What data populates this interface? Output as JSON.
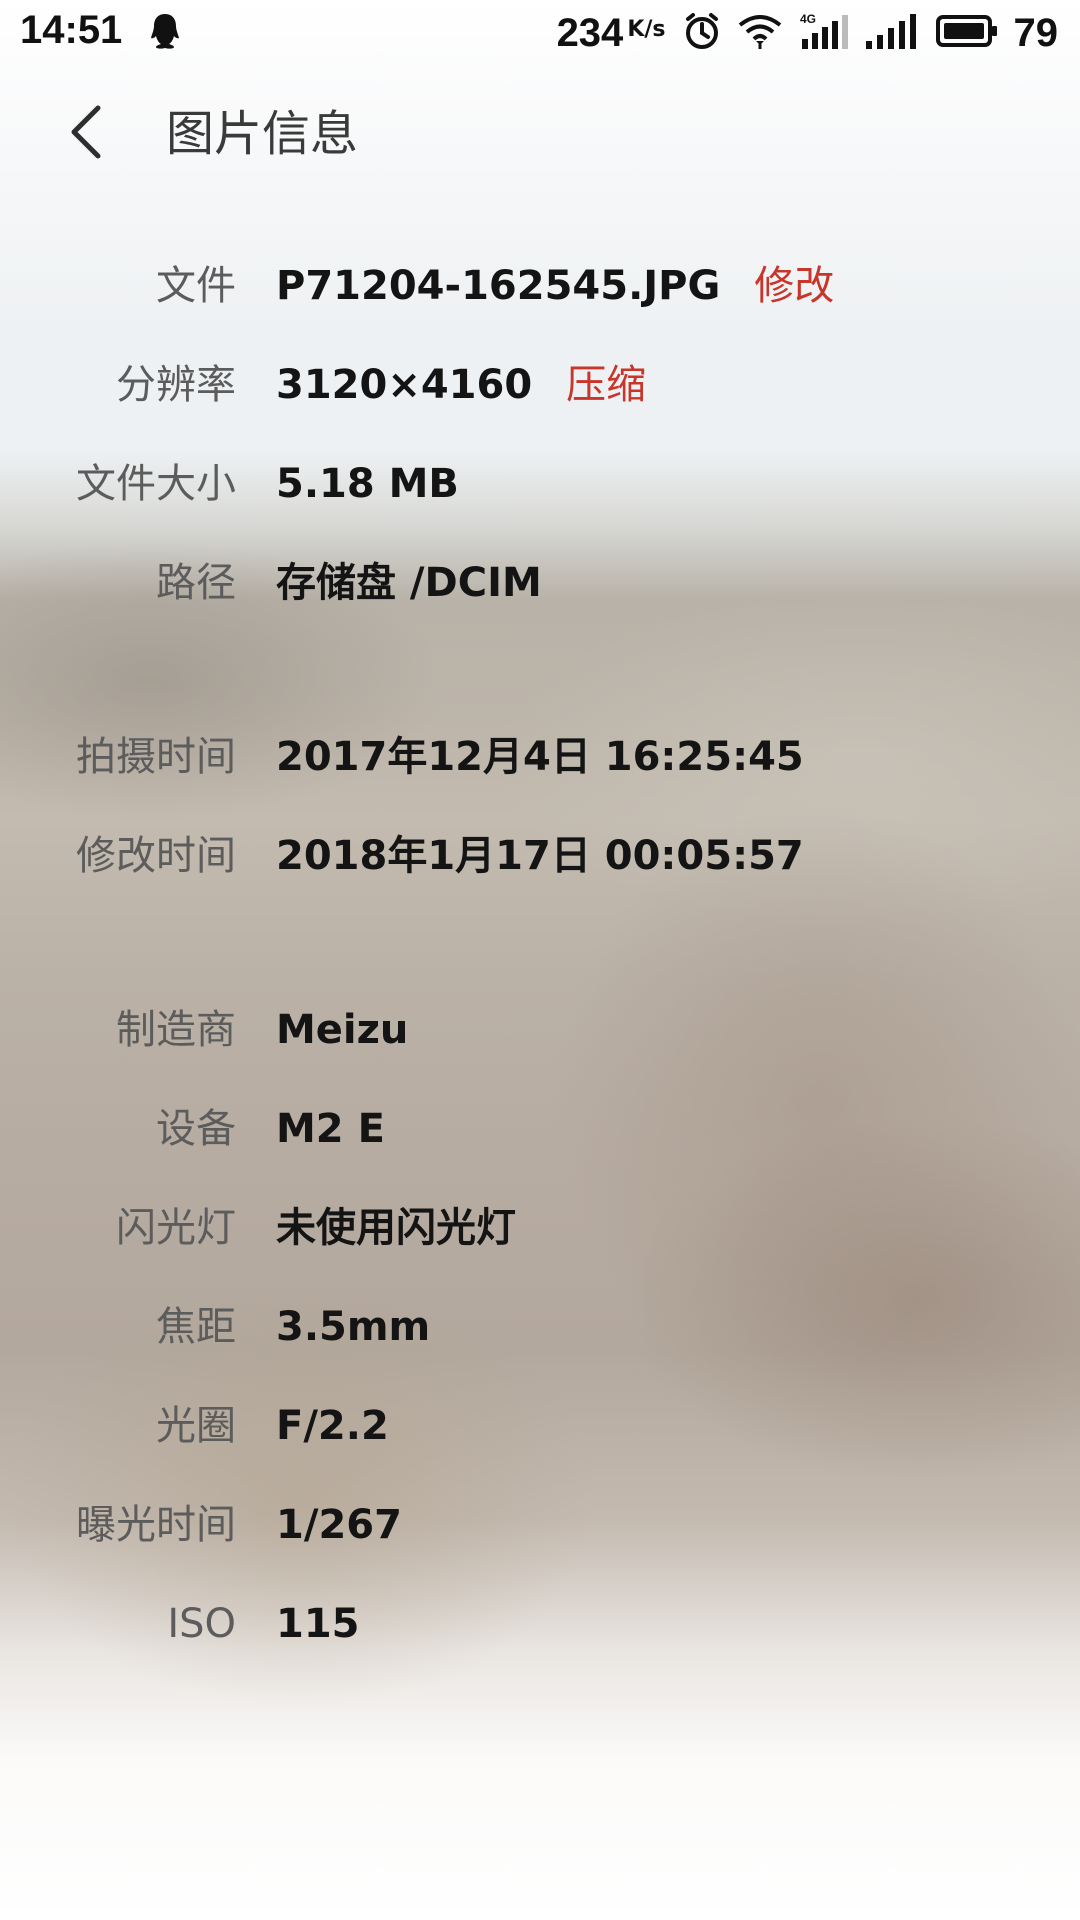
{
  "status_bar": {
    "time": "14:51",
    "net_speed": "234",
    "net_speed_unit": "K/s",
    "battery_percent": "79",
    "icons": [
      "qq-notification-icon",
      "alarm-icon",
      "wifi-icon",
      "4g-signal-icon",
      "signal-icon",
      "battery-icon"
    ]
  },
  "header": {
    "back_icon": "chevron-left-icon",
    "title": "图片信息"
  },
  "info": {
    "file": {
      "label": "文件",
      "value": "P71204-162545.JPG",
      "action": "修改"
    },
    "resolution": {
      "label": "分辨率",
      "value": "3120×4160",
      "action": "压缩"
    },
    "size": {
      "label": "文件大小",
      "value": "5.18 MB"
    },
    "path": {
      "label": "路径",
      "value": "存储盘 /DCIM"
    },
    "shot_time": {
      "label": "拍摄时间",
      "value": "2017年12月4日 16:25:45"
    },
    "modified_time": {
      "label": "修改时间",
      "value": "2018年1月17日 00:05:57"
    },
    "maker": {
      "label": "制造商",
      "value": "Meizu"
    },
    "device": {
      "label": "设备",
      "value": "M2 E"
    },
    "flash": {
      "label": "闪光灯",
      "value": "未使用闪光灯"
    },
    "focal_length": {
      "label": "焦距",
      "value": "3.5mm"
    },
    "aperture": {
      "label": "光圈",
      "value": "F/2.2"
    },
    "exposure": {
      "label": "曝光时间",
      "value": "1/267"
    },
    "iso": {
      "label": "ISO",
      "value": "115"
    }
  },
  "colors": {
    "accent": "#c8352a",
    "label": "#5c5c5c",
    "value": "#141414"
  }
}
